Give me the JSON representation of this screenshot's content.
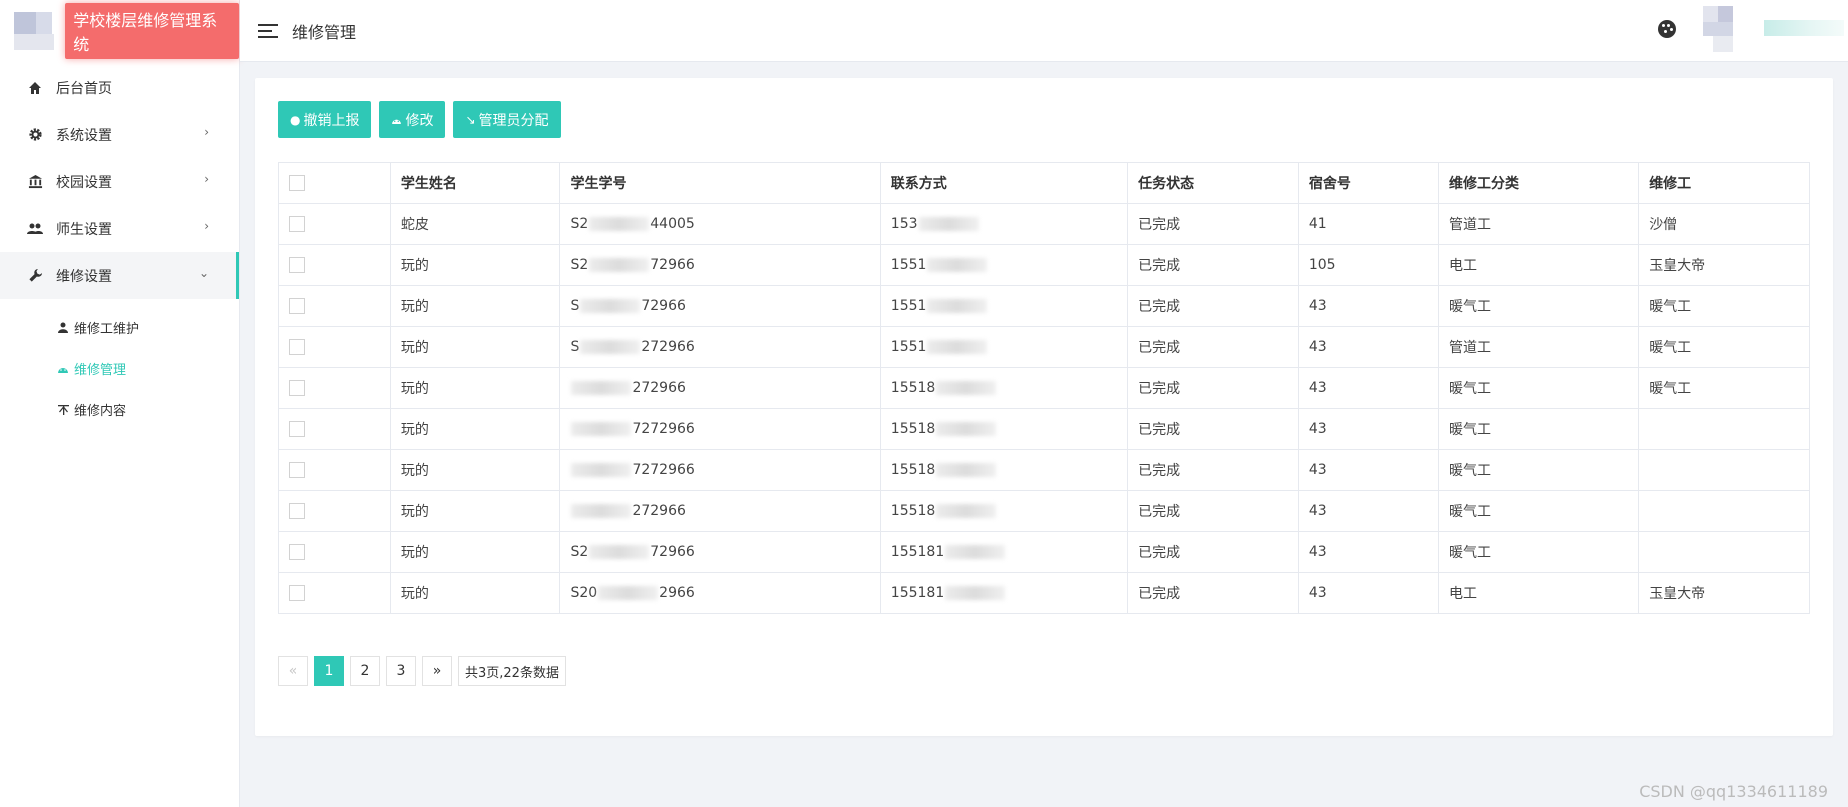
{
  "brand": {
    "title": "学校楼层维修管理系统"
  },
  "header": {
    "title": "维修管理"
  },
  "sidebar": {
    "items": [
      {
        "label": "后台首页",
        "icon": "home-icon"
      },
      {
        "label": "系统设置",
        "icon": "gear-icon",
        "chevron": "›"
      },
      {
        "label": "校园设置",
        "icon": "bank-icon",
        "chevron": "›"
      },
      {
        "label": "师生设置",
        "icon": "users-icon",
        "chevron": "›"
      },
      {
        "label": "维修设置",
        "icon": "wrench-icon",
        "chevron": "⌄"
      }
    ],
    "subitems": [
      {
        "label": "维修工维护",
        "icon": "user-icon"
      },
      {
        "label": "维修管理",
        "icon": "android-icon"
      },
      {
        "label": "维修内容",
        "icon": "list-icon"
      }
    ]
  },
  "toolbar": {
    "cancel_label": "撤销上报",
    "edit_label": "修改",
    "assign_label": "管理员分配"
  },
  "table": {
    "columns": [
      "学生姓名",
      "学生学号",
      "联系方式",
      "任务状态",
      "宿舍号",
      "维修工分类",
      "维修工"
    ],
    "rows": [
      {
        "name": "蛇皮",
        "id_prefix": "S2",
        "id_suffix": "44005",
        "phone": "153",
        "status": "已完成",
        "room": "41",
        "category": "管道工",
        "worker": "沙僧"
      },
      {
        "name": "玩的",
        "id_prefix": "S2",
        "id_suffix": "72966",
        "phone": "1551",
        "status": "已完成",
        "room": "105",
        "category": "电工",
        "worker": "玉皇大帝"
      },
      {
        "name": "玩的",
        "id_prefix": "S",
        "id_suffix": "72966",
        "phone": "1551",
        "status": "已完成",
        "room": "43",
        "category": "暖气工",
        "worker": "暖气工"
      },
      {
        "name": "玩的",
        "id_prefix": "S",
        "id_suffix": "272966",
        "phone": "1551",
        "status": "已完成",
        "room": "43",
        "category": "管道工",
        "worker": "暖气工"
      },
      {
        "name": "玩的",
        "id_prefix": "",
        "id_suffix": "272966",
        "phone": "15518",
        "status": "已完成",
        "room": "43",
        "category": "暖气工",
        "worker": "暖气工"
      },
      {
        "name": "玩的",
        "id_prefix": "",
        "id_suffix": "7272966",
        "phone": "15518",
        "status": "已完成",
        "room": "43",
        "category": "暖气工",
        "worker": ""
      },
      {
        "name": "玩的",
        "id_prefix": "",
        "id_suffix": "7272966",
        "phone": "15518",
        "status": "已完成",
        "room": "43",
        "category": "暖气工",
        "worker": ""
      },
      {
        "name": "玩的",
        "id_prefix": "",
        "id_suffix": "272966",
        "phone": "15518",
        "status": "已完成",
        "room": "43",
        "category": "暖气工",
        "worker": ""
      },
      {
        "name": "玩的",
        "id_prefix": "S2",
        "id_suffix": "72966",
        "phone": "155181",
        "status": "已完成",
        "room": "43",
        "category": "暖气工",
        "worker": ""
      },
      {
        "name": "玩的",
        "id_prefix": "S20",
        "id_suffix": "2966",
        "phone": "155181",
        "status": "已完成",
        "room": "43",
        "category": "电工",
        "worker": "玉皇大帝"
      }
    ]
  },
  "pager": {
    "prev": "«",
    "pages": [
      "1",
      "2",
      "3"
    ],
    "current": "1",
    "next": "»",
    "info": "共3页,22条数据"
  },
  "colors": {
    "accent": "#2fc8b6",
    "status_done": "#f39c4b",
    "brand_bg": "#f46c6c"
  },
  "watermark": "CSDN @qq1334611189"
}
